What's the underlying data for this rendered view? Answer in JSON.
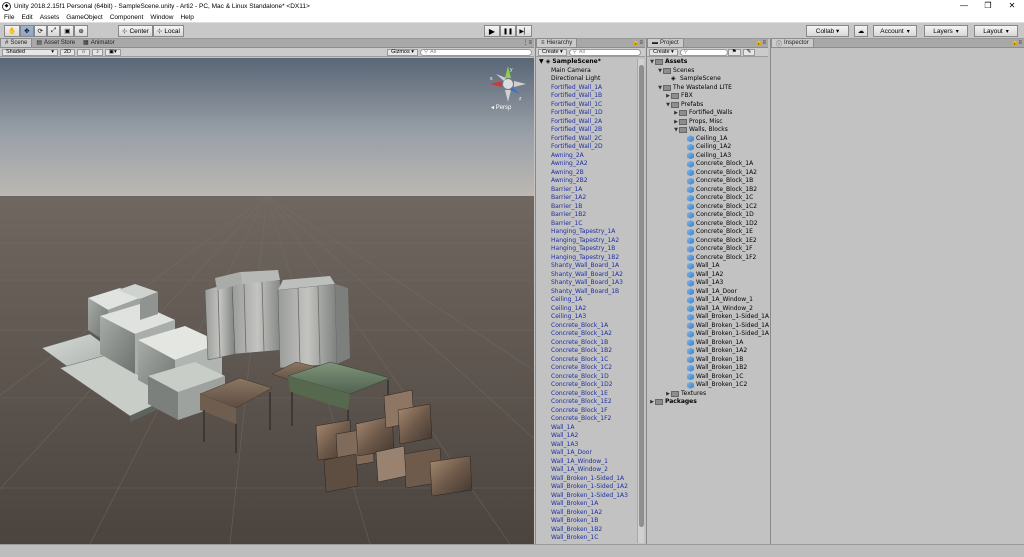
{
  "window": {
    "title": "Unity 2018.2.15f1 Personal (64bit) - SampleScene.unity - Arti2 - PC, Mac & Linux Standalone* <DX11>",
    "controls": [
      "—",
      "❒",
      "✕"
    ]
  },
  "menu": [
    "File",
    "Edit",
    "Assets",
    "GameObject",
    "Component",
    "Window",
    "Help"
  ],
  "toolbar": {
    "pivot": "Center",
    "space": "Local",
    "play_icon": "▶",
    "pause_icon": "❚❚",
    "step_icon": "▶▏",
    "collab": "Collab ▾",
    "account": "Account",
    "layers": "Layers",
    "layout": "Layout"
  },
  "scene_panel": {
    "tabs": [
      "Scene",
      "Asset Store",
      "Animator"
    ],
    "shading": "Shaded",
    "mode_2d": "2D",
    "gizmos": "Gizmos ▾",
    "search": "All",
    "camera_mode": "Persp"
  },
  "hierarchy": {
    "tab": "Hierarchy",
    "create": "Create ▾",
    "search": "All",
    "scene": "SampleScene*",
    "plain_items": [
      "Main Camera",
      "Directional Light"
    ],
    "items": [
      "Fortified_Wall_1A",
      "Fortified_Wall_1B",
      "Fortified_Wall_1C",
      "Fortified_Wall_1D",
      "Fortified_Wall_2A",
      "Fortified_Wall_2B",
      "Fortified_Wall_2C",
      "Fortified_Wall_2D",
      "Awning_2A",
      "Awning_2A2",
      "Awning_2B",
      "Awning_2B2",
      "Barrier_1A",
      "Barrier_1A2",
      "Barrier_1B",
      "Barrier_1B2",
      "Barrier_1C",
      "Hanging_Tapestry_1A",
      "Hanging_Tapestry_1A2",
      "Hanging_Tapestry_1B",
      "Hanging_Tapestry_1B2",
      "Shanty_Wall_Board_1A",
      "Shanty_Wall_Board_1A2",
      "Shanty_Wall_Board_1A3",
      "Shanty_Wall_Board_1B",
      "Ceiling_1A",
      "Ceiling_1A2",
      "Ceiling_1A3",
      "Concrete_Block_1A",
      "Concrete_Block_1A2",
      "Concrete_Block_1B",
      "Concrete_Block_1B2",
      "Concrete_Block_1C",
      "Concrete_Block_1C2",
      "Concrete_Block_1D",
      "Concrete_Block_1D2",
      "Concrete_Block_1E",
      "Concrete_Block_1E2",
      "Concrete_Block_1F",
      "Concrete_Block_1F2",
      "Wall_1A",
      "Wall_1A2",
      "Wall_1A3",
      "Wall_1A_Door",
      "Wall_1A_Window_1",
      "Wall_1A_Window_2",
      "Wall_Broken_1-Sided_1A",
      "Wall_Broken_1-Sided_1A2",
      "Wall_Broken_1-Sided_1A3",
      "Wall_Broken_1A",
      "Wall_Broken_1A2",
      "Wall_Broken_1B",
      "Wall_Broken_1B2",
      "Wall_Broken_1C"
    ]
  },
  "project": {
    "tab": "Project",
    "create": "Create ▾",
    "tree": [
      {
        "label": "Assets",
        "indent": 0,
        "icon": "folder",
        "arrow": "▼",
        "bold": true
      },
      {
        "label": "Scenes",
        "indent": 1,
        "icon": "folder",
        "arrow": "▼"
      },
      {
        "label": "SampleScene",
        "indent": 2,
        "icon": "scene",
        "arrow": ""
      },
      {
        "label": "The Wasteland LITE",
        "indent": 1,
        "icon": "folder",
        "arrow": "▼"
      },
      {
        "label": "FBX",
        "indent": 2,
        "icon": "folder",
        "arrow": "▶"
      },
      {
        "label": "Prefabs",
        "indent": 2,
        "icon": "folder",
        "arrow": "▼"
      },
      {
        "label": "Fortified_Walls",
        "indent": 3,
        "icon": "folder",
        "arrow": "▶"
      },
      {
        "label": "Props, Misc",
        "indent": 3,
        "icon": "folder",
        "arrow": "▶"
      },
      {
        "label": "Walls, Blocks",
        "indent": 3,
        "icon": "folder",
        "arrow": "▼"
      },
      {
        "label": "Ceiling_1A",
        "indent": 4,
        "icon": "prefab"
      },
      {
        "label": "Ceiling_1A2",
        "indent": 4,
        "icon": "prefab"
      },
      {
        "label": "Ceiling_1A3",
        "indent": 4,
        "icon": "prefab"
      },
      {
        "label": "Concrete_Block_1A",
        "indent": 4,
        "icon": "prefab"
      },
      {
        "label": "Concrete_Block_1A2",
        "indent": 4,
        "icon": "prefab"
      },
      {
        "label": "Concrete_Block_1B",
        "indent": 4,
        "icon": "prefab"
      },
      {
        "label": "Concrete_Block_1B2",
        "indent": 4,
        "icon": "prefab"
      },
      {
        "label": "Concrete_Block_1C",
        "indent": 4,
        "icon": "prefab"
      },
      {
        "label": "Concrete_Block_1C2",
        "indent": 4,
        "icon": "prefab"
      },
      {
        "label": "Concrete_Block_1D",
        "indent": 4,
        "icon": "prefab"
      },
      {
        "label": "Concrete_Block_1D2",
        "indent": 4,
        "icon": "prefab"
      },
      {
        "label": "Concrete_Block_1E",
        "indent": 4,
        "icon": "prefab"
      },
      {
        "label": "Concrete_Block_1E2",
        "indent": 4,
        "icon": "prefab"
      },
      {
        "label": "Concrete_Block_1F",
        "indent": 4,
        "icon": "prefab"
      },
      {
        "label": "Concrete_Block_1F2",
        "indent": 4,
        "icon": "prefab"
      },
      {
        "label": "Wall_1A",
        "indent": 4,
        "icon": "prefab"
      },
      {
        "label": "Wall_1A2",
        "indent": 4,
        "icon": "prefab"
      },
      {
        "label": "Wall_1A3",
        "indent": 4,
        "icon": "prefab"
      },
      {
        "label": "Wall_1A_Door",
        "indent": 4,
        "icon": "prefab"
      },
      {
        "label": "Wall_1A_Window_1",
        "indent": 4,
        "icon": "prefab"
      },
      {
        "label": "Wall_1A_Window_2",
        "indent": 4,
        "icon": "prefab"
      },
      {
        "label": "Wall_Broken_1-Sided_1A",
        "indent": 4,
        "icon": "prefab"
      },
      {
        "label": "Wall_Broken_1-Sided_1A",
        "indent": 4,
        "icon": "prefab"
      },
      {
        "label": "Wall_Broken_1-Sided_1A",
        "indent": 4,
        "icon": "prefab"
      },
      {
        "label": "Wall_Broken_1A",
        "indent": 4,
        "icon": "prefab"
      },
      {
        "label": "Wall_Broken_1A2",
        "indent": 4,
        "icon": "prefab"
      },
      {
        "label": "Wall_Broken_1B",
        "indent": 4,
        "icon": "prefab"
      },
      {
        "label": "Wall_Broken_1B2",
        "indent": 4,
        "icon": "prefab"
      },
      {
        "label": "Wall_Broken_1C",
        "indent": 4,
        "icon": "prefab"
      },
      {
        "label": "Wall_Broken_1C2",
        "indent": 4,
        "icon": "prefab"
      },
      {
        "label": "Textures",
        "indent": 2,
        "icon": "folder",
        "arrow": "▶"
      },
      {
        "label": "Packages",
        "indent": 0,
        "icon": "folder",
        "arrow": "▶",
        "bold": true
      }
    ]
  },
  "inspector": {
    "tab": "Inspector"
  },
  "colors": {
    "sky_top": "#5c6878",
    "sky_bottom": "#b9b6b2",
    "ground": "#524a44",
    "hierarchy_text": "#1e2fa0"
  }
}
